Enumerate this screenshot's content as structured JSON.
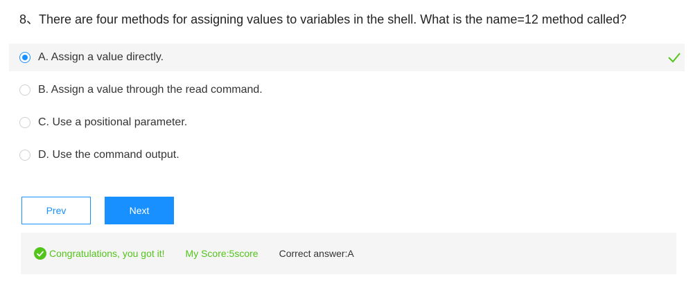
{
  "question": {
    "text": "8、There are four methods for assigning values to variables in the shell. What is the name=12 method called?"
  },
  "options": [
    {
      "label": "A. Assign a value directly.",
      "selected": true
    },
    {
      "label": "B. Assign a value through the read command.",
      "selected": false
    },
    {
      "label": "C. Use a positional parameter.",
      "selected": false
    },
    {
      "label": "D. Use the command output.",
      "selected": false
    }
  ],
  "buttons": {
    "prev_label": "Prev",
    "next_label": "Next"
  },
  "result": {
    "congrats": "Congratulations, you got it!",
    "score": "My Score:5score",
    "correct_answer": "Correct answer:A"
  },
  "colors": {
    "accent": "#1890ff",
    "success": "#52c41a"
  }
}
